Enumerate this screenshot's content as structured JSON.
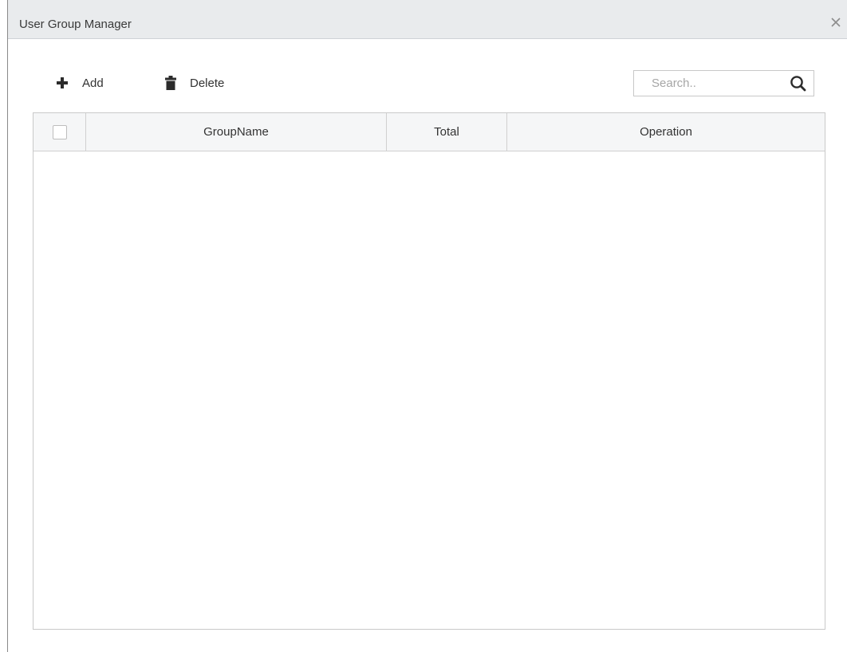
{
  "dialog": {
    "title": "User Group Manager",
    "close_icon": "close-icon"
  },
  "toolbar": {
    "add_label": "Add",
    "add_icon": "plus-icon",
    "delete_label": "Delete",
    "delete_icon": "trash-icon"
  },
  "search": {
    "placeholder": "Search..",
    "value": "",
    "icon": "search-icon"
  },
  "table": {
    "columns": [
      "",
      "GroupName",
      "Total",
      "Operation"
    ],
    "rows": []
  },
  "colors": {
    "titlebar_bg": "#e9ebed",
    "header_bg": "#f5f6f7",
    "border": "#c9c9c9",
    "text": "#333333"
  }
}
